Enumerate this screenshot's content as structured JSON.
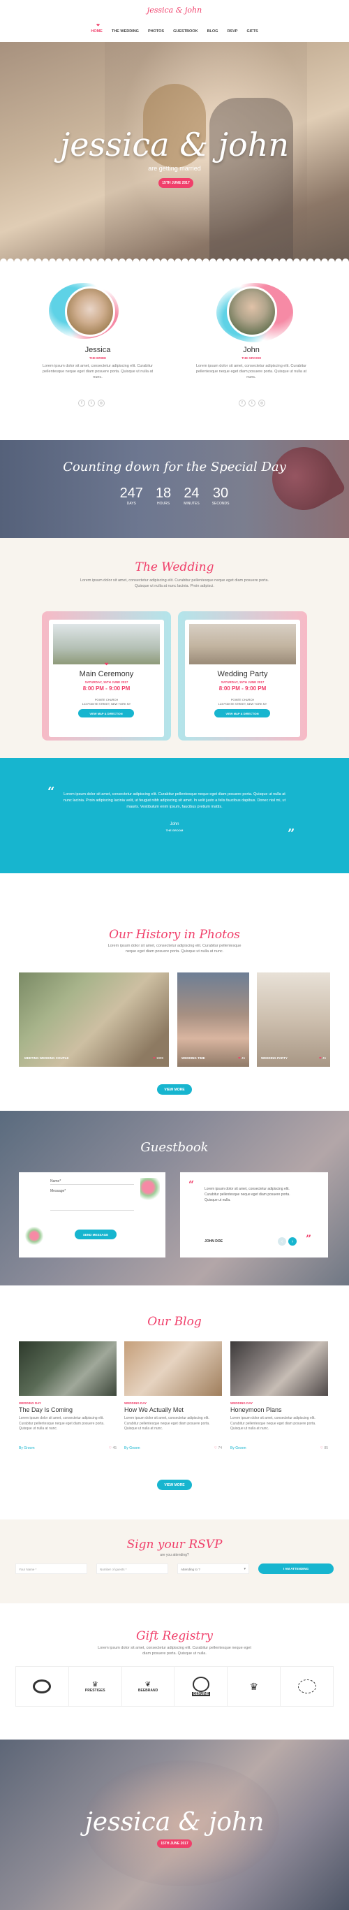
{
  "brand": "jessica & john",
  "nav": [
    "HOME",
    "THE WEDDING",
    "PHOTOS",
    "GUESTBOOK",
    "BLOG",
    "RSVP",
    "GIFTS"
  ],
  "hero": {
    "title": "jessica & john",
    "subtitle": "are getting married",
    "date_button": "15TH JUNE 2017"
  },
  "couple": [
    {
      "name": "Jessica",
      "role": "THE BRIDE",
      "text": "Lorem ipsum dolor sit amet, consectetur adipiscing elit. Curabitur pellentesque neque eget diam posuere porta. Quisque ut nulla at nunc."
    },
    {
      "name": "John",
      "role": "THE GROOM",
      "text": "Lorem ipsum dolor sit amet, consectetur adipiscing elit. Curabitur pellentesque neque eget diam posuere porta. Quisque ut nulla at nunc."
    }
  ],
  "countdown": {
    "title": "Counting down for the Special Day",
    "items": [
      {
        "value": "247",
        "label": "DAYS"
      },
      {
        "value": "18",
        "label": "HOURS"
      },
      {
        "value": "24",
        "label": "MINUTES"
      },
      {
        "value": "30",
        "label": "SECONDS"
      }
    ]
  },
  "wedding": {
    "title": "The Wedding",
    "intro": "Lorem ipsum dolor sit amet, consectetur adipiscing elit. Curabitur pellentesque neque eget diam posuere porta. Quisque ut nulla at nunc lacinia. Proin adipisci.",
    "cards": [
      {
        "title": "Main Ceremony",
        "date": "SATURDAY, 15TH JUNE 2017",
        "time": "8:00 PM - 9:00 PM",
        "place": "POINTE CHURCH",
        "address": "123 POINTE STREET, NEW YORK NY",
        "button": "VIEW MAP & DIRECTION"
      },
      {
        "title": "Wedding Party",
        "date": "SATURDAY, 15TH JUNE 2017",
        "time": "8:00 PM - 9:00 PM",
        "place": "POINTE CHURCH",
        "address": "123 POINTE STREET, NEW YORK NY",
        "button": "VIEW MAP & DIRECTION"
      }
    ]
  },
  "quote": {
    "text": "Lorem ipsum dolor sit amet, consectetur adipiscing elit. Curabitur pellentesque neque eget diam posuere porta. Quisque ut nulla at nunc lacinia. Proin adipiscing lacinia velit, ut feugiat nibh adipiscing sit amet. In velit justo a felis faucibus dapibus. Donec nisl mi, ut mauris. Vestibulum enim ipsum, faucibus pretium mattis.",
    "name": "John",
    "role": "THE GROOM"
  },
  "photos": {
    "title": "Our History in Photos",
    "intro": "Lorem ipsum dolor sit amet, consectetur adipiscing elit. Curabitur pellentesque neque eget diam posuere porta. Quisque ut nulla at nunc.",
    "items": [
      {
        "caption": "MEETING WEDDING COUPLE",
        "count": "1999"
      },
      {
        "caption": "WEDDING TIME",
        "count": "45"
      },
      {
        "caption": "WEDDING PARTY",
        "count": "45"
      }
    ],
    "button": "VIEW MORE"
  },
  "guestbook": {
    "title": "Guestbook",
    "name_label": "Name*",
    "message_label": "Message*",
    "submit": "SEND MESSAGE",
    "entry_text": "Lorem ipsum dolor sit amet, consectetur adipiscing elit. Curabitur pellentesque neque eget diam posuere porta. Quisque ut nulla.",
    "entry_name": "JOHN DOE"
  },
  "blog": {
    "title": "Our Blog",
    "posts": [
      {
        "category": "WEDDING DAY",
        "title": "The Day Is Coming",
        "text": "Lorem ipsum dolor sit amet, consectetur adipiscing elit. Curabitur pellentesque neque eget diam posuere porta. Quisque ut nulla at nunc.",
        "author": "By Groom",
        "likes": "45"
      },
      {
        "category": "WEDDING DAY",
        "title": "How We Actually Met",
        "text": "Lorem ipsum dolor sit amet, consectetur adipiscing elit. Curabitur pellentesque neque eget diam posuere porta. Quisque ut nulla at nunc.",
        "author": "By Groom",
        "likes": "74"
      },
      {
        "category": "WEDDING DAY",
        "title": "Honeymoon Plans",
        "text": "Lorem ipsum dolor sit amet, consectetur adipiscing elit. Curabitur pellentesque neque eget diam posuere porta. Quisque ut nulla at nunc.",
        "author": "By Groom",
        "likes": "85"
      }
    ],
    "button": "VIEW MORE"
  },
  "rsvp": {
    "title": "Sign your RSVP",
    "subtitle": "are you attending?",
    "name_ph": "Your Name *",
    "guests_ph": "Number of guests *",
    "attending": "Attending to ?",
    "button": "I AM ATTENDING"
  },
  "gifts": {
    "title": "Gift Registry",
    "intro": "Lorem ipsum dolor sit amet, consectetur adipiscing elit. Curabitur pellentesque neque eget diam posuere porta. Quisque ut nulla.",
    "logos": [
      "",
      "PRESTIGES",
      "BEEBRAND",
      "GENUINE",
      "",
      ""
    ]
  },
  "footer": {
    "title": "jessica & john",
    "date": "15TH JUNE 2017"
  }
}
